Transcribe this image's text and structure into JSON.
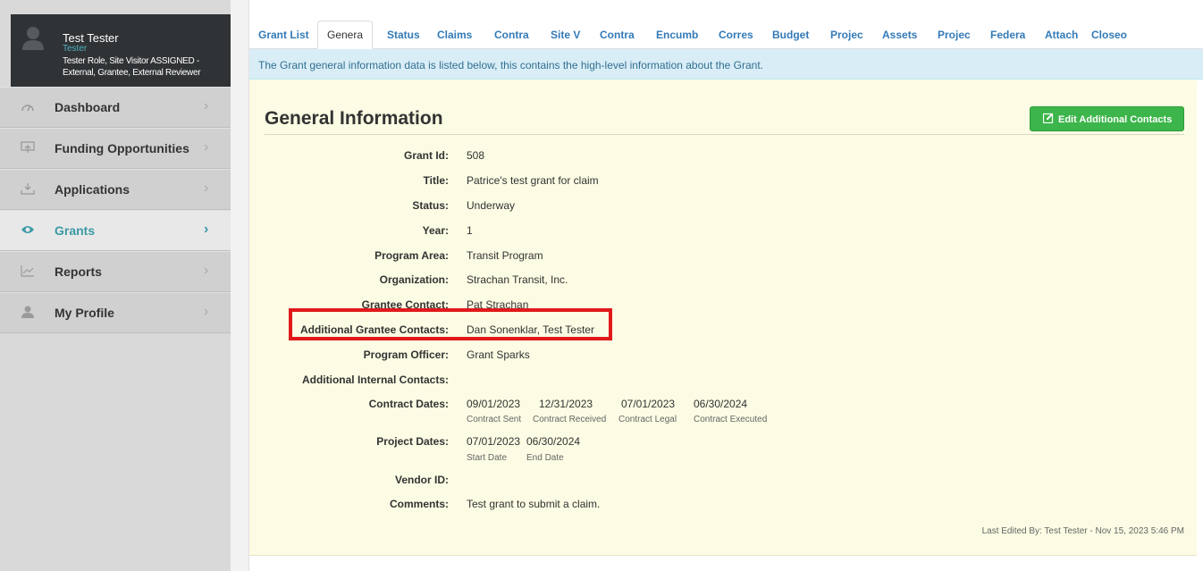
{
  "user": {
    "name": "Test Tester",
    "subtitle": "Tester",
    "role": "Tester Role, Site Visitor ASSIGNED - External, Grantee, External Reviewer"
  },
  "nav": {
    "items": [
      {
        "label": "Dashboard",
        "icon": "speedometer-icon"
      },
      {
        "label": "Funding Opportunities",
        "icon": "upload-box-icon"
      },
      {
        "label": "Applications",
        "icon": "download-tray-icon"
      },
      {
        "label": "Grants",
        "icon": "eye-icon",
        "active": true
      },
      {
        "label": "Reports",
        "icon": "line-chart-icon"
      },
      {
        "label": "My Profile",
        "icon": "user-icon"
      }
    ]
  },
  "tabs": [
    "Grant List",
    "Genera",
    "Status",
    "Claims",
    "Contra",
    "Site V",
    "Contra",
    "Encumb",
    "Corres",
    "Budget",
    "Projec",
    "Assets",
    "Projec",
    "Federa",
    "Attach",
    "Closeo"
  ],
  "info_text": "The Grant general information data is listed below, this contains the high-level information about the Grant.",
  "section": {
    "title": "General Information",
    "edit_button": "Edit Additional Contacts"
  },
  "fields": {
    "grant_id": {
      "label": "Grant Id:",
      "value": "508"
    },
    "title": {
      "label": "Title:",
      "value": "Patrice's test grant for claim"
    },
    "status": {
      "label": "Status:",
      "value": "Underway"
    },
    "year": {
      "label": "Year:",
      "value": "1"
    },
    "program_area": {
      "label": "Program Area:",
      "value": "Transit Program"
    },
    "organization": {
      "label": "Organization:",
      "value": "Strachan Transit, Inc."
    },
    "grantee_contact": {
      "label": "Grantee Contact:",
      "value": "Pat Strachan"
    },
    "additional_grantee_contacts": {
      "label": "Additional Grantee Contacts:",
      "value": "Dan Sonenklar, Test Tester"
    },
    "program_officer": {
      "label": "Program Officer:",
      "value": "Grant Sparks"
    },
    "additional_internal_contacts": {
      "label": "Additional Internal Contacts:",
      "value": ""
    },
    "contract_dates": {
      "label": "Contract Dates:",
      "dates": [
        "09/01/2023",
        "12/31/2023",
        "07/01/2023",
        "06/30/2024"
      ],
      "captions": [
        "Contract Sent",
        "Contract Received",
        "Contract Legal",
        "Contract Executed"
      ]
    },
    "project_dates": {
      "label": "Project Dates:",
      "dates": [
        "07/01/2023",
        "06/30/2024"
      ],
      "captions": [
        "Start Date",
        "End Date"
      ]
    },
    "vendor_id": {
      "label": "Vendor ID:",
      "value": ""
    },
    "comments": {
      "label": "Comments:",
      "value": "Test grant to submit a claim."
    }
  },
  "last_edited": "Last Edited By: Test Tester - Nov 15, 2023 5:46 PM",
  "colors": {
    "accent": "#3a9aa6",
    "button_green": "#3cb54a",
    "info_bg": "#d9edf7",
    "panel_bg": "#fcfbe3",
    "highlight_red": "#e0191b"
  }
}
